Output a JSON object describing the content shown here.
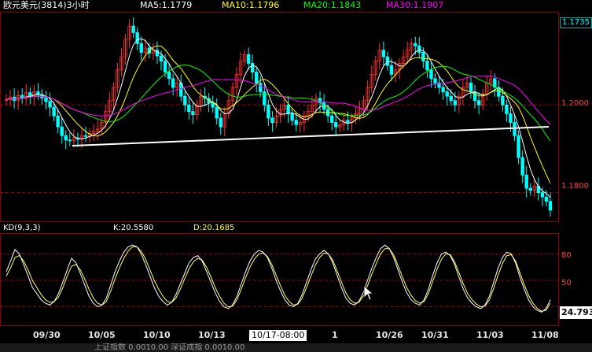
{
  "header": {
    "symbol": "欧元美元(3814)3小时",
    "ma5": "MA5:1.1779",
    "ma10": "MA10:1.1796",
    "ma20": "MA20:1.1843",
    "ma30": "MA30:1.1907"
  },
  "price_panel": {
    "top_price": "1.1735",
    "level_high": "1.2000",
    "level_low": "1.1800"
  },
  "kd_panel": {
    "title": "KD(9,3,3)",
    "k": "K:20.5580",
    "d": "D:20.1685",
    "level_80": "80",
    "level_50": "50",
    "current_value": "24.793"
  },
  "x_axis": {
    "labels": [
      "09/30",
      "10/05",
      "10/10",
      "10/13",
      "10/17-08:00",
      "1",
      "10/26",
      "10/31",
      "11/03",
      "11/08"
    ]
  },
  "status_bar": {
    "text": "上证指数 0.0010.00 深证成指 0.0010.00"
  },
  "colors": {
    "ma5": "#ffffff",
    "ma10": "#ffff00",
    "ma20": "#00ff00",
    "ma30": "#ff00ff",
    "up": "#ff3030",
    "down": "#00ffff"
  },
  "chart_data": {
    "type": "line",
    "price_levels": [
      1.1735,
      1.2,
      1.18
    ],
    "x_labels": [
      "09/30",
      "10/05",
      "10/10",
      "10/13",
      "10/17-08:00",
      "1",
      "10/26",
      "10/31",
      "11/03",
      "11/08"
    ],
    "close_series": [
      1.2012,
      1.2018,
      1.201,
      1.2022,
      1.2015,
      1.2028,
      1.202,
      1.203,
      1.2024,
      1.2016,
      1.2008,
      1.1995,
      1.1975,
      1.195,
      1.193,
      1.192,
      1.1918,
      1.1925,
      1.1922,
      1.193,
      1.1928,
      1.1935,
      1.194,
      1.1945,
      1.196,
      1.1985,
      1.201,
      1.204,
      1.208,
      1.211,
      1.215,
      1.218,
      1.2165,
      1.214,
      1.212,
      1.213,
      1.2118,
      1.2125,
      1.2112,
      1.21,
      1.2075,
      1.206,
      1.204,
      1.205,
      1.202,
      1.2,
      1.1985,
      1.1978,
      1.2,
      1.202,
      1.2015,
      1.2005,
      1.1995,
      1.197,
      1.195,
      1.198,
      1.201,
      1.204,
      1.207,
      1.21,
      1.2115,
      1.2095,
      1.2075,
      1.205,
      1.203,
      1.2,
      1.197,
      1.196,
      1.1975,
      1.199,
      1.2,
      1.198,
      1.1965,
      1.1955,
      1.196,
      1.1975,
      1.1985,
      1.2,
      1.2015,
      1.2005,
      1.199,
      1.1975,
      1.196,
      1.195,
      1.1955,
      1.1965,
      1.196,
      1.197,
      1.198,
      1.199,
      1.201,
      1.204,
      1.207,
      1.21,
      1.2125,
      1.211,
      1.209,
      1.207,
      1.208,
      1.2095,
      1.211,
      1.2125,
      1.214,
      1.2135,
      1.212,
      1.21,
      1.208,
      1.206,
      1.205,
      1.204,
      1.203,
      1.202,
      1.201,
      1.2,
      1.202,
      1.204,
      1.205,
      1.203,
      1.201,
      1.2,
      1.2025,
      1.205,
      1.206,
      1.204,
      1.202,
      1.2,
      1.198,
      1.196,
      1.193,
      1.188,
      1.184,
      1.181,
      1.1805,
      1.1815,
      1.18,
      1.179,
      1.178,
      1.176
    ],
    "kd_k": [
      60,
      72,
      85,
      80,
      68,
      55,
      42,
      35,
      28,
      24,
      22,
      26,
      35,
      48,
      62,
      75,
      70,
      58,
      45,
      32,
      24,
      20,
      22,
      30,
      45,
      60,
      72,
      82,
      88,
      90,
      88,
      80,
      68,
      55,
      42,
      32,
      26,
      22,
      25,
      34,
      46,
      58,
      70,
      76,
      78,
      72,
      60,
      48,
      36,
      26,
      20,
      18,
      22,
      32,
      46,
      60,
      72,
      80,
      84,
      82,
      76,
      64,
      50,
      38,
      28,
      22,
      20,
      24,
      34,
      48,
      62,
      74,
      80,
      84,
      80,
      70,
      56,
      42,
      30,
      24,
      22,
      26,
      36,
      50,
      64,
      76,
      86,
      90,
      86,
      76,
      62,
      48,
      36,
      28,
      24,
      22,
      28,
      40,
      56,
      70,
      80,
      82,
      78,
      68,
      54,
      40,
      30,
      24,
      20,
      18,
      22,
      32,
      48,
      64,
      76,
      82,
      80,
      70,
      54,
      40,
      28,
      20,
      16,
      14,
      18,
      28
    ],
    "kd_d": [
      55,
      64,
      76,
      78,
      72,
      62,
      50,
      42,
      34,
      28,
      25,
      26,
      31,
      42,
      55,
      66,
      68,
      62,
      52,
      40,
      30,
      24,
      22,
      26,
      38,
      52,
      64,
      75,
      83,
      88,
      88,
      83,
      74,
      62,
      50,
      40,
      32,
      26,
      25,
      30,
      40,
      52,
      63,
      71,
      75,
      73,
      65,
      54,
      42,
      32,
      24,
      20,
      21,
      28,
      40,
      53,
      65,
      74,
      80,
      81,
      77,
      68,
      56,
      44,
      33,
      26,
      22,
      23,
      30,
      42,
      55,
      67,
      76,
      81,
      80,
      73,
      61,
      48,
      36,
      28,
      24,
      25,
      32,
      44,
      57,
      69,
      80,
      86,
      86,
      79,
      67,
      54,
      42,
      33,
      27,
      24,
      26,
      35,
      49,
      63,
      74,
      80,
      79,
      71,
      59,
      46,
      35,
      28,
      23,
      20,
      21,
      28,
      41,
      56,
      69,
      78,
      79,
      72,
      59,
      45,
      33,
      24,
      18,
      15,
      16,
      24
    ]
  }
}
